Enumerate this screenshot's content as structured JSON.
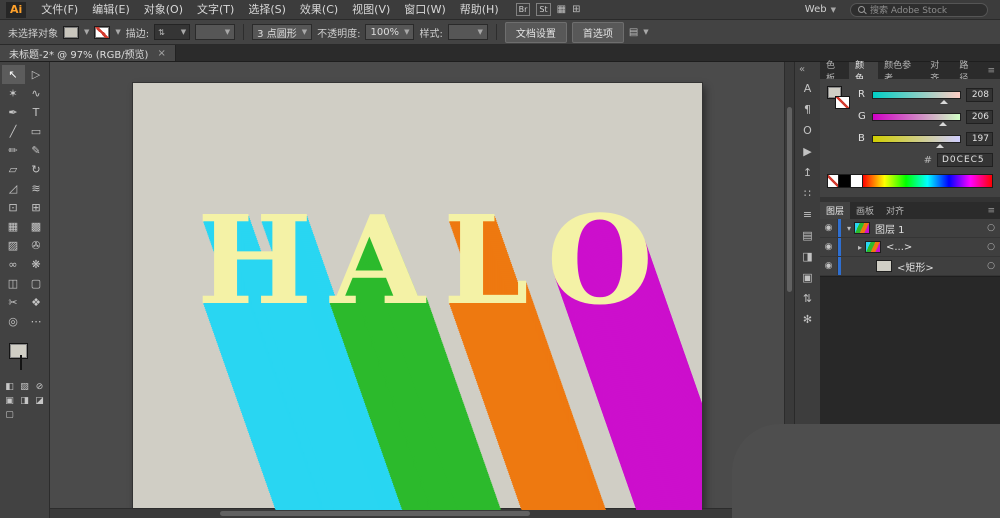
{
  "menu_bar": {
    "logo": "Ai",
    "items": [
      "文件(F)",
      "编辑(E)",
      "对象(O)",
      "文字(T)",
      "选择(S)",
      "效果(C)",
      "视图(V)",
      "窗口(W)",
      "帮助(H)"
    ],
    "app_icons": [
      {
        "name": "bridge-icon",
        "glyph": "Br"
      },
      {
        "name": "stock-icon",
        "glyph": "St"
      },
      {
        "name": "arrange-documents-icon",
        "glyph": "▦"
      },
      {
        "name": "application-bar-grid-icon",
        "glyph": "⊞"
      }
    ],
    "workspace": "Web",
    "search_placeholder": "搜索 Adobe Stock"
  },
  "control_bar": {
    "status": "未选择对象",
    "stroke_label": "描边:",
    "brush_value": "3 点圆形",
    "opacity_label": "不透明度:",
    "opacity_value": "100%",
    "style_label": "样式:",
    "doc_setup_button": "文档设置",
    "preferences_button": "首选项"
  },
  "doc_tab": {
    "title": "未标题-2* @ 97% (RGB/预览)",
    "close": "×"
  },
  "tools": [
    {
      "name": "selection-tool",
      "glyph": "↖"
    },
    {
      "name": "direct-selection-tool",
      "glyph": "▷"
    },
    {
      "name": "magic-wand-tool",
      "glyph": "✶"
    },
    {
      "name": "lasso-tool",
      "glyph": "∿"
    },
    {
      "name": "pen-tool",
      "glyph": "✒"
    },
    {
      "name": "type-tool",
      "glyph": "T"
    },
    {
      "name": "line-segment-tool",
      "glyph": "╱"
    },
    {
      "name": "rectangle-tool",
      "glyph": "▭"
    },
    {
      "name": "paintbrush-tool",
      "glyph": "✏"
    },
    {
      "name": "pencil-tool",
      "glyph": "✎"
    },
    {
      "name": "eraser-tool",
      "glyph": "▱"
    },
    {
      "name": "rotate-tool",
      "glyph": "↻"
    },
    {
      "name": "scale-tool",
      "glyph": "◿"
    },
    {
      "name": "width-tool",
      "glyph": "≋"
    },
    {
      "name": "free-transform-tool",
      "glyph": "⊡"
    },
    {
      "name": "shape-builder-tool",
      "glyph": "⊞"
    },
    {
      "name": "perspective-grid-tool",
      "glyph": "▦"
    },
    {
      "name": "mesh-tool",
      "glyph": "▩"
    },
    {
      "name": "gradient-tool",
      "glyph": "▨"
    },
    {
      "name": "eyedropper-tool",
      "glyph": "✇"
    },
    {
      "name": "blend-tool",
      "glyph": "∞"
    },
    {
      "name": "symbol-sprayer-tool",
      "glyph": "❋"
    },
    {
      "name": "column-graph-tool",
      "glyph": "◫"
    },
    {
      "name": "artboard-tool",
      "glyph": "▢"
    },
    {
      "name": "slice-tool",
      "glyph": "✂"
    },
    {
      "name": "hand-tool",
      "glyph": "❖"
    },
    {
      "name": "zoom-tool",
      "glyph": "◎"
    },
    {
      "name": "more-tools",
      "glyph": "⋯"
    }
  ],
  "toolbar_bottom": {
    "fill_color": "#D0CEC5",
    "icons": [
      {
        "name": "color-button",
        "glyph": "◧"
      },
      {
        "name": "gradient-button",
        "glyph": "▨"
      },
      {
        "name": "none-button",
        "glyph": "⊘"
      },
      {
        "name": "draw-normal-mode-button",
        "glyph": "▣"
      },
      {
        "name": "draw-behind-mode-button",
        "glyph": "◨"
      },
      {
        "name": "draw-inside-mode-button",
        "glyph": "◪"
      },
      {
        "name": "screen-mode-button",
        "glyph": "▢"
      }
    ]
  },
  "canvas": {
    "background": "#4B4B4B",
    "artboard_color": "#D0CEC5",
    "word": "HALO",
    "letter_color": "#F4F2A6",
    "letters": [
      {
        "char": "H",
        "shadow_color": "#29D6F2"
      },
      {
        "char": "A",
        "shadow_color": "#2CBA2C"
      },
      {
        "char": "L",
        "shadow_color": "#EE7910"
      },
      {
        "char": "O",
        "shadow_color": "#CC0FCC"
      }
    ]
  },
  "dock": {
    "collapse_glyph": "«",
    "icons": [
      {
        "name": "character-panel-icon",
        "glyph": "A"
      },
      {
        "name": "paragraph-panel-icon",
        "glyph": "¶"
      },
      {
        "name": "opentype-panel-icon",
        "glyph": "O"
      },
      {
        "name": "actions-panel-icon",
        "glyph": "▶"
      },
      {
        "name": "export-panel-icon",
        "glyph": "↥"
      },
      {
        "name": "app-grid-icon",
        "glyph": "∷"
      },
      {
        "name": "appearance-panel-icon",
        "glyph": "≡"
      },
      {
        "name": "swatches-panel-icon",
        "glyph": "▤"
      },
      {
        "name": "symbols-panel-icon",
        "glyph": "◨"
      },
      {
        "name": "libraries-panel-icon",
        "glyph": "▣"
      },
      {
        "name": "transform-panel-icon",
        "glyph": "⇅"
      },
      {
        "name": "settings-icon",
        "glyph": "✻"
      }
    ]
  },
  "color_panel": {
    "tabs": [
      {
        "label": "色板",
        "active": false
      },
      {
        "label": "颜色",
        "active": true
      },
      {
        "label": "颜色参考",
        "active": false
      },
      {
        "label": "对齐",
        "active": false
      },
      {
        "label": "路径",
        "active": false
      }
    ],
    "menu_glyph": "≡",
    "channels": [
      {
        "label": "R",
        "value": "208",
        "from": "#00CEC5",
        "to": "#FFCEC5",
        "pos": 81.6
      },
      {
        "label": "G",
        "value": "206",
        "from": "#D000C5",
        "to": "#D0FFC5",
        "pos": 80.8
      },
      {
        "label": "B",
        "value": "197",
        "from": "#D0CE00",
        "to": "#D0CEFF",
        "pos": 77.3
      }
    ],
    "hex_label": "#",
    "hex_value": "D0CEC5"
  },
  "layers_panel": {
    "tabs": [
      {
        "label": "图层",
        "active": true
      },
      {
        "label": "画板",
        "active": false
      },
      {
        "label": "对齐",
        "active": false
      }
    ],
    "menu_glyph": "≡",
    "eye_glyph": "◉",
    "target_glyph": "○",
    "rows": [
      {
        "label": "图层 1",
        "arrow": "▾",
        "indent": 0,
        "thumb": "art"
      },
      {
        "label": "<...>",
        "arrow": "▸",
        "indent": 1,
        "thumb": "art"
      },
      {
        "label": "<矩形>",
        "arrow": "",
        "indent": 2,
        "thumb": "rect"
      }
    ]
  }
}
